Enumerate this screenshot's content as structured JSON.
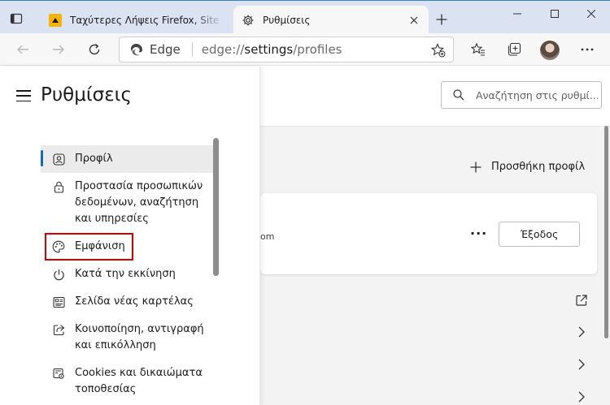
{
  "tabs": [
    {
      "title": "Ταχύτερες Λήψεις Firefox, Site c",
      "active": false,
      "favicon": "site-favicon-yellow"
    },
    {
      "title": "Ρυθμίσεις",
      "active": true,
      "favicon": "gear-icon"
    }
  ],
  "omnibox": {
    "brand": "Edge",
    "url_scheme": "edge://",
    "url_host": "settings",
    "url_path": "/profiles"
  },
  "settings": {
    "title": "Ρυθμίσεις",
    "search_placeholder": "Αναζήτηση στις ρυθμί...",
    "nav": [
      {
        "label": "Προφίλ",
        "icon": "profile-icon",
        "selected": true
      },
      {
        "label": "Προστασία προσωπικών δεδομένων, αναζήτηση και υπηρεσίες",
        "icon": "lock-icon"
      },
      {
        "label": "Εμφάνιση",
        "icon": "palette-icon",
        "highlighted": true
      },
      {
        "label": "Κατά την εκκίνηση",
        "icon": "power-icon"
      },
      {
        "label": "Σελίδα νέας καρτέλας",
        "icon": "new-tab-page-icon"
      },
      {
        "label": "Κοινοποίηση, αντιγραφή και επικόλληση",
        "icon": "share-icon"
      },
      {
        "label": "Cookies και δικαιώματα τοποθεσίας",
        "icon": "cookies-icon"
      }
    ],
    "main": {
      "add_profile_label": "Προσθήκη προφίλ",
      "email_tail": "om",
      "more_label": "···",
      "signout_label": "Έξοδος"
    }
  },
  "colors": {
    "accent": "#0f6cbd",
    "highlight_box": "#d20000",
    "tabstrip": "#dbe3f3"
  }
}
